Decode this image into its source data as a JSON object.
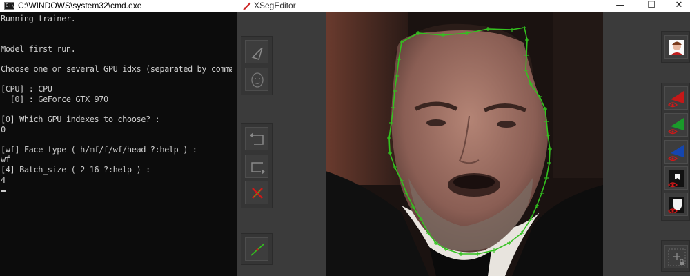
{
  "cmd": {
    "title": "C:\\WINDOWS\\system32\\cmd.exe",
    "icon_label": "C:\\",
    "lines": [
      "Running trainer.",
      "",
      "",
      "Model first run.",
      "",
      "Choose one or several GPU idxs (separated by comma).",
      "",
      "[CPU] : CPU",
      "  [0] : GeForce GTX 970",
      "",
      "[0] Which GPU indexes to choose? :",
      "0",
      "",
      "[wf] Face type ( h/mf/f/wf/head ?:help ) :",
      "wf",
      "[4] Batch_size ( 2-16 ?:help ) :",
      "4"
    ]
  },
  "xseg": {
    "title": "XSegEditor",
    "window_controls": {
      "minimize": "—",
      "maximize": "☐",
      "close": "✕"
    },
    "left_tools": [
      {
        "name": "poly-include-mode-button",
        "icon": "poly-triangle-icon"
      },
      {
        "name": "poly-exclude-mode-button",
        "icon": "face-outline-icon"
      },
      {
        "name": "undo-point-button",
        "icon": "undo-arrow-icon"
      },
      {
        "name": "redo-point-button",
        "icon": "redo-arrow-icon"
      },
      {
        "name": "delete-poly-button",
        "icon": "red-x-icon"
      },
      {
        "name": "view-lines-button",
        "icon": "green-line-icon"
      }
    ],
    "right_tools": [
      {
        "name": "view-baked-mask-button",
        "icon": "face-avatar-icon"
      },
      {
        "name": "view-red-mask-button",
        "icon": "red-triangle-eye-icon"
      },
      {
        "name": "view-green-mask-button",
        "icon": "green-triangle-eye-icon"
      },
      {
        "name": "view-blue-mask-button",
        "icon": "blue-triangle-eye-icon"
      },
      {
        "name": "view-bw-mask-button",
        "icon": "bw-mask-eye-icon"
      },
      {
        "name": "view-face-mask-button",
        "icon": "white-face-eye-icon"
      },
      {
        "name": "add-lock-button",
        "icon": "plus-lock-icon"
      }
    ],
    "colors": {
      "polygon": "#33c21f",
      "background": "#3b3b3b",
      "accent_red": "#d01818"
    }
  }
}
